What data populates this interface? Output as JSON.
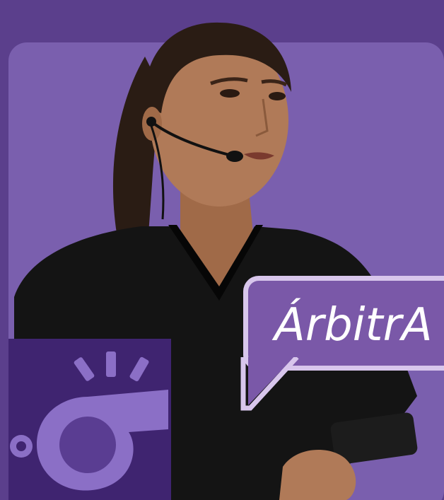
{
  "bubble": {
    "label": "ÁrbitrA"
  },
  "colors": {
    "background": "#5b3f8c",
    "panel": "#7a5fae",
    "bubble_fill": "#7a58a8",
    "bubble_border": "#d8c6ec",
    "whistle_box": "#3f2470",
    "whistle_light": "#8b6fc6",
    "whistle_dark": "#5a3d92",
    "jersey": "#141414",
    "skin": "#b07a58",
    "hair": "#2a1c14"
  },
  "icons": {
    "whistle": "whistle-icon",
    "headset": "headset-icon",
    "armband": "armband-icon"
  }
}
